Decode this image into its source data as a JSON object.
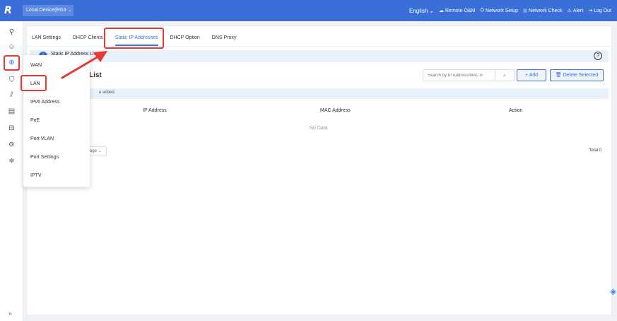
{
  "header": {
    "logo": "R",
    "device_label": "Local Device(EG3",
    "nav": {
      "language": "English",
      "remote": "Remote O&M",
      "network_setup": "Network Setup",
      "network_check": "Network Check",
      "alert": "Alert",
      "logout": "Log Out"
    }
  },
  "rail": {
    "expand": "»"
  },
  "tabs": [
    {
      "label": "LAN Settings"
    },
    {
      "label": "DHCP Clients"
    },
    {
      "label": "Static IP Addresses"
    },
    {
      "label": "DHCP Option"
    },
    {
      "label": "DNS Proxy"
    }
  ],
  "banner": {
    "icon": "i",
    "title": "Static IP Address List",
    "help": "?"
  },
  "list": {
    "title": "List",
    "search_placeholder": "Search by IP Address/MAC A",
    "add_label": "+ Add",
    "delete_label": "Delete Selected",
    "note": "e added.",
    "columns": [
      "IP Address",
      "MAC Address",
      "Action"
    ],
    "empty": "No Data",
    "pager_label": "age",
    "total": "Total 0"
  },
  "submenu": [
    {
      "label": "WAN"
    },
    {
      "label": "LAN"
    },
    {
      "label": "IPv6 Address"
    },
    {
      "label": "PoE"
    },
    {
      "label": "Port VLAN"
    },
    {
      "label": "Port Settings"
    },
    {
      "label": "IPTV"
    }
  ],
  "colors": {
    "accent": "#3a6fd8",
    "annotation": "#e53935"
  }
}
